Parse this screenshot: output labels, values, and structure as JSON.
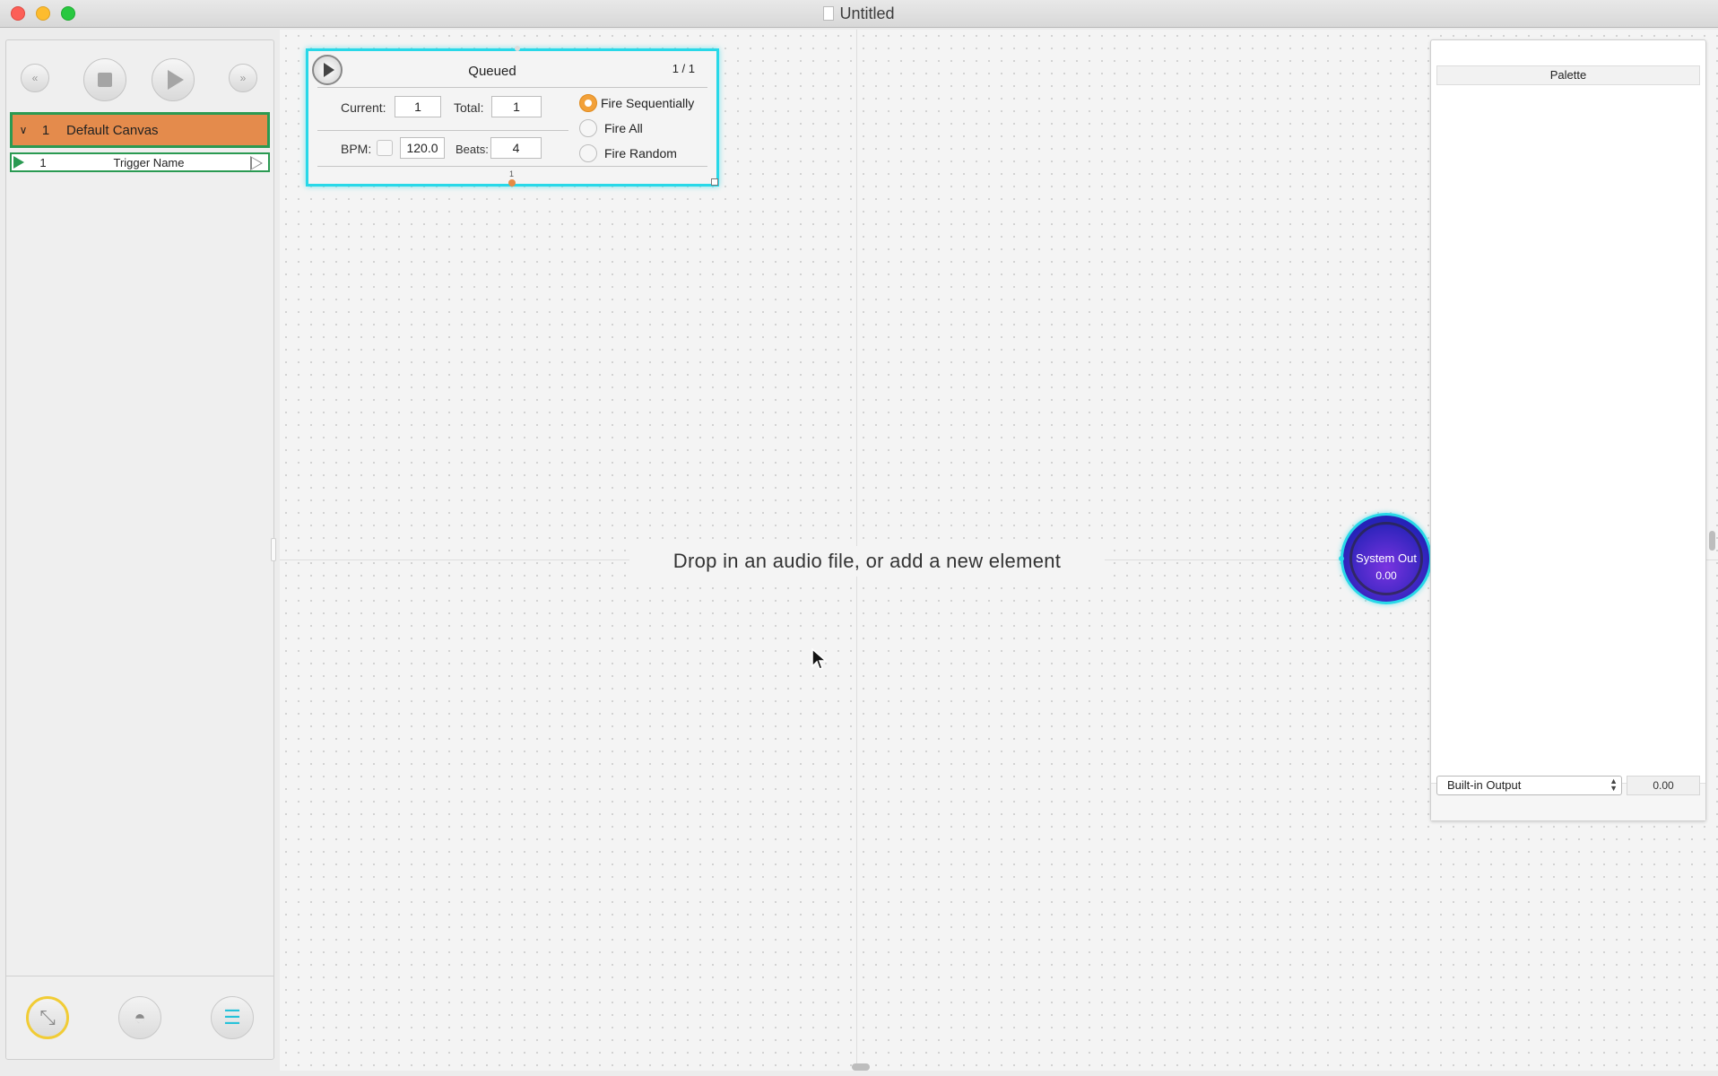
{
  "window": {
    "title": "Untitled"
  },
  "transport": {
    "rewind_glyph": "«",
    "forward_glyph": "»"
  },
  "sidebar": {
    "canvas": {
      "chevron": "∨",
      "number": "1",
      "name": "Default Canvas"
    },
    "trigger": {
      "number": "1",
      "name": "Trigger Name"
    },
    "mode_buttons": [
      {
        "icon": "wand-icon",
        "glyph": "⤡"
      },
      {
        "icon": "waveform-icon",
        "glyph": "◓"
      },
      {
        "icon": "list-icon",
        "glyph": "☰"
      }
    ]
  },
  "trigger_panel": {
    "status": "Queued",
    "count": "1 / 1",
    "current_label": "Current:",
    "current_value": "1",
    "total_label": "Total:",
    "total_value": "1",
    "bpm_label": "BPM:",
    "bpm_value": "120.0",
    "beats_label": "Beats:",
    "beats_value": "4",
    "modes": [
      {
        "label": "Fire Sequentially",
        "selected": true
      },
      {
        "label": "Fire All",
        "selected": false
      },
      {
        "label": "Fire Random",
        "selected": false
      }
    ],
    "bottom_marker_label": "1"
  },
  "canvas": {
    "hint": "Drop in an audio file, or add a new element"
  },
  "system_out": {
    "name": "System Out",
    "value": "0.00"
  },
  "palette": {
    "title": "Palette",
    "output_device": "Built-in Output",
    "output_value": "0.00"
  },
  "colors": {
    "accent_cyan": "#28d8e8",
    "canvas_row_orange": "#e48b4c",
    "selection_green": "#2a9a52",
    "radio_orange": "#f2a13a",
    "system_out_purple": "#7a34e0"
  }
}
